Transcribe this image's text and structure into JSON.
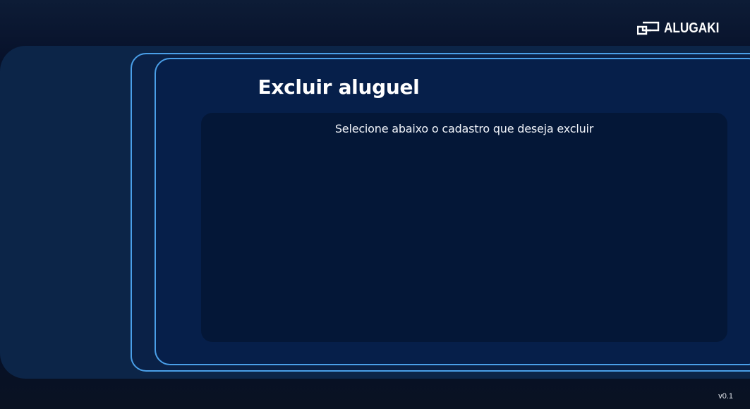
{
  "brand": {
    "name": "ALUGAKI",
    "logo_icon": "alugaki-logo-icon"
  },
  "page": {
    "title": "Excluir aluguel",
    "instruction": "Selecione abaixo o cadastro que deseja excluir"
  },
  "footer": {
    "version": "v0.1"
  },
  "colors": {
    "accent_border": "#4a9fe8",
    "panel": "#0c2548",
    "content_bg": "#041737",
    "text": "#ffffff"
  }
}
